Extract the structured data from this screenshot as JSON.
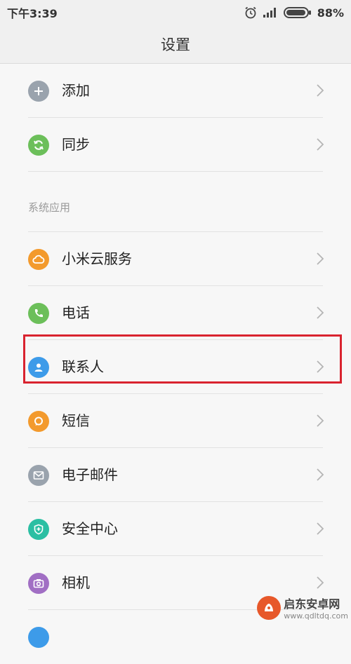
{
  "status_bar": {
    "time": "下午3:39",
    "battery": "88%"
  },
  "header": {
    "title": "设置"
  },
  "top_items": [
    {
      "label": "添加",
      "icon": "plus-icon",
      "color": "#9aa3ad"
    },
    {
      "label": "同步",
      "icon": "sync-icon",
      "color": "#6cbf5a"
    }
  ],
  "section": {
    "title": "系统应用"
  },
  "system_items": [
    {
      "label": "小米云服务",
      "icon": "cloud-icon",
      "color": "#f39a2d"
    },
    {
      "label": "电话",
      "icon": "phone-icon",
      "color": "#6cbf5a"
    },
    {
      "label": "联系人",
      "icon": "contact-icon",
      "color": "#3d9be9"
    },
    {
      "label": "短信",
      "icon": "message-icon",
      "color": "#f39a2d"
    },
    {
      "label": "电子邮件",
      "icon": "mail-icon",
      "color": "#9aa3ad"
    },
    {
      "label": "安全中心",
      "icon": "shield-icon",
      "color": "#2bbfa3"
    },
    {
      "label": "相机",
      "icon": "camera-icon",
      "color": "#a16fc4"
    }
  ],
  "watermark": {
    "name": "启东安卓网",
    "url": "www.qdltdq.com"
  }
}
